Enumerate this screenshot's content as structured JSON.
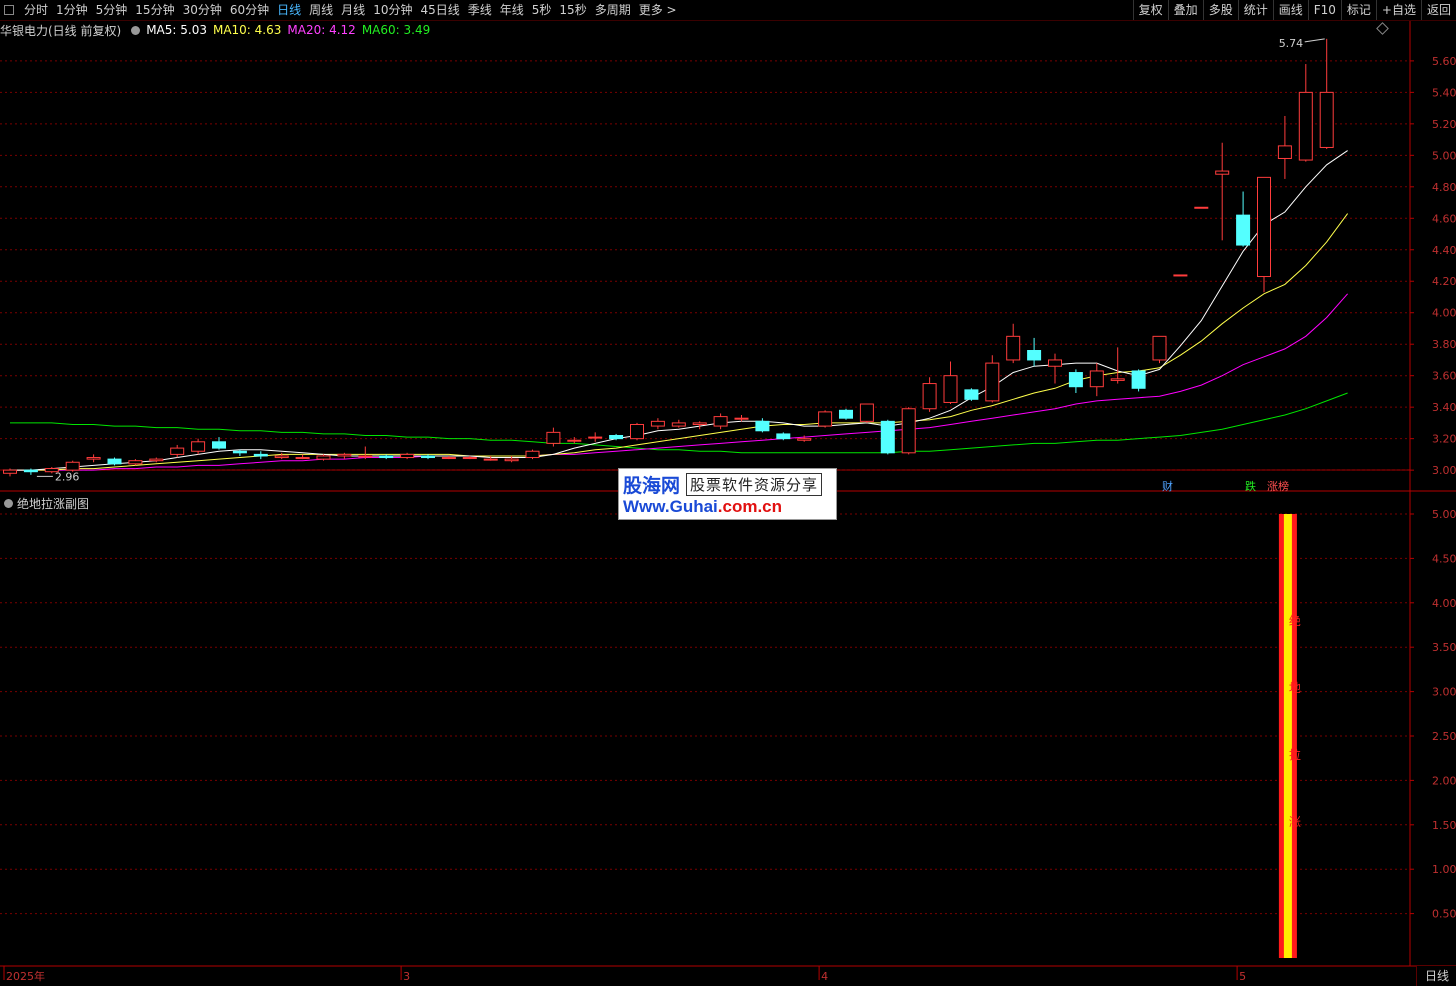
{
  "toolbar": {
    "periods": [
      "分时",
      "1分钟",
      "5分钟",
      "15分钟",
      "30分钟",
      "60分钟",
      "日线",
      "周线",
      "月线",
      "10分钟",
      "45日线",
      "季线",
      "年线",
      "5秒",
      "15秒",
      "多周期",
      "更多 >"
    ],
    "active_period": "日线",
    "actions": [
      "复权",
      "叠加",
      "多股",
      "统计",
      "画线",
      "F10",
      "标记",
      "+自选",
      "返回"
    ]
  },
  "info": {
    "title": "华银电力(日线 前复权)",
    "ma5": "MA5: 5.03",
    "ma10": "MA10: 4.63",
    "ma20": "MA20: 4.12",
    "ma60": "MA60: 3.49"
  },
  "colors": {
    "up": "#ff3c3c",
    "down": "#54ffff",
    "ma5": "#ffffff",
    "ma10": "#ffff4c",
    "ma20": "#ff00ff",
    "ma60": "#00e600",
    "axis": "#b40000",
    "grid": "#7a0000"
  },
  "subchart": {
    "title": "绝地拉涨副图"
  },
  "watermark": {
    "logo": "股海网",
    "tagline": "股票软件资源分享",
    "url_pre": "Www.",
    "url_mid": "Guhai",
    "url_post": ".com.cn"
  },
  "period_button": "日线",
  "chart_data": [
    {
      "type": "candlestick",
      "ylim": [
        2.95,
        5.72
      ],
      "yticks": [
        "3.00",
        "3.20",
        "3.40",
        "3.60",
        "3.80",
        "4.00",
        "4.20",
        "4.40",
        "4.60",
        "4.80",
        "5.00",
        "5.20",
        "5.40",
        "5.60"
      ],
      "ytick_values": [
        3.0,
        3.2,
        3.4,
        3.6,
        3.8,
        4.0,
        4.2,
        4.4,
        4.6,
        4.8,
        5.0,
        5.2,
        5.4,
        5.6
      ],
      "annotations": {
        "high": "5.74",
        "low": "2.96",
        "events": [
          "财",
          "跌",
          "涨榜"
        ]
      },
      "x_labels": [
        "2025年",
        "3",
        "4",
        "5"
      ],
      "x_label_index": [
        0,
        19,
        39,
        59
      ],
      "candles": [
        {
          "o": 2.98,
          "c": 3.0,
          "h": 3.01,
          "l": 2.96
        },
        {
          "o": 3.0,
          "c": 2.99,
          "h": 3.01,
          "l": 2.97
        },
        {
          "o": 2.99,
          "c": 3.01,
          "h": 3.02,
          "l": 2.98
        },
        {
          "o": 3.0,
          "c": 3.05,
          "h": 3.06,
          "l": 2.99
        },
        {
          "o": 3.07,
          "c": 3.08,
          "h": 3.1,
          "l": 3.05
        },
        {
          "o": 3.07,
          "c": 3.04,
          "h": 3.08,
          "l": 3.03
        },
        {
          "o": 3.04,
          "c": 3.06,
          "h": 3.07,
          "l": 3.03
        },
        {
          "o": 3.06,
          "c": 3.07,
          "h": 3.08,
          "l": 3.05
        },
        {
          "o": 3.1,
          "c": 3.14,
          "h": 3.16,
          "l": 3.08
        },
        {
          "o": 3.12,
          "c": 3.18,
          "h": 3.2,
          "l": 3.1
        },
        {
          "o": 3.18,
          "c": 3.14,
          "h": 3.21,
          "l": 3.13
        },
        {
          "o": 3.12,
          "c": 3.11,
          "h": 3.13,
          "l": 3.09
        },
        {
          "o": 3.1,
          "c": 3.09,
          "h": 3.12,
          "l": 3.07
        },
        {
          "o": 3.08,
          "c": 3.09,
          "h": 3.11,
          "l": 3.07
        },
        {
          "o": 3.08,
          "c": 3.08,
          "h": 3.1,
          "l": 3.07
        },
        {
          "o": 3.07,
          "c": 3.09,
          "h": 3.1,
          "l": 3.06
        },
        {
          "o": 3.09,
          "c": 3.1,
          "h": 3.11,
          "l": 3.07
        },
        {
          "o": 3.09,
          "c": 3.09,
          "h": 3.15,
          "l": 3.07
        },
        {
          "o": 3.09,
          "c": 3.08,
          "h": 3.1,
          "l": 3.07
        },
        {
          "o": 3.08,
          "c": 3.1,
          "h": 3.11,
          "l": 3.07
        },
        {
          "o": 3.09,
          "c": 3.08,
          "h": 3.1,
          "l": 3.07
        },
        {
          "o": 3.08,
          "c": 3.08,
          "h": 3.09,
          "l": 3.07
        },
        {
          "o": 3.08,
          "c": 3.08,
          "h": 3.09,
          "l": 3.07
        },
        {
          "o": 3.07,
          "c": 3.07,
          "h": 3.09,
          "l": 3.06
        },
        {
          "o": 3.06,
          "c": 3.07,
          "h": 3.09,
          "l": 3.05
        },
        {
          "o": 3.08,
          "c": 3.12,
          "h": 3.13,
          "l": 3.07
        },
        {
          "o": 3.17,
          "c": 3.24,
          "h": 3.27,
          "l": 3.15
        },
        {
          "o": 3.19,
          "c": 3.19,
          "h": 3.21,
          "l": 3.17
        },
        {
          "o": 3.21,
          "c": 3.21,
          "h": 3.24,
          "l": 3.18
        },
        {
          "o": 3.22,
          "c": 3.2,
          "h": 3.23,
          "l": 3.19
        },
        {
          "o": 3.2,
          "c": 3.29,
          "h": 3.3,
          "l": 3.19
        },
        {
          "o": 3.28,
          "c": 3.31,
          "h": 3.33,
          "l": 3.26
        },
        {
          "o": 3.28,
          "c": 3.3,
          "h": 3.32,
          "l": 3.27
        },
        {
          "o": 3.29,
          "c": 3.3,
          "h": 3.31,
          "l": 3.26
        },
        {
          "o": 3.28,
          "c": 3.34,
          "h": 3.36,
          "l": 3.26
        },
        {
          "o": 3.33,
          "c": 3.33,
          "h": 3.35,
          "l": 3.31
        },
        {
          "o": 3.31,
          "c": 3.25,
          "h": 3.33,
          "l": 3.24
        },
        {
          "o": 3.23,
          "c": 3.2,
          "h": 3.24,
          "l": 3.19
        },
        {
          "o": 3.19,
          "c": 3.2,
          "h": 3.22,
          "l": 3.18
        },
        {
          "o": 3.28,
          "c": 3.37,
          "h": 3.38,
          "l": 3.27
        },
        {
          "o": 3.38,
          "c": 3.33,
          "h": 3.39,
          "l": 3.32
        },
        {
          "o": 3.31,
          "c": 3.42,
          "h": 3.42,
          "l": 3.3
        },
        {
          "o": 3.31,
          "c": 3.11,
          "h": 3.32,
          "l": 3.1
        },
        {
          "o": 3.11,
          "c": 3.39,
          "h": 3.4,
          "l": 3.1
        },
        {
          "o": 3.39,
          "c": 3.55,
          "h": 3.59,
          "l": 3.37
        },
        {
          "o": 3.43,
          "c": 3.6,
          "h": 3.69,
          "l": 3.42
        },
        {
          "o": 3.51,
          "c": 3.45,
          "h": 3.52,
          "l": 3.44
        },
        {
          "o": 3.44,
          "c": 3.68,
          "h": 3.73,
          "l": 3.43
        },
        {
          "o": 3.7,
          "c": 3.85,
          "h": 3.93,
          "l": 3.68
        },
        {
          "o": 3.76,
          "c": 3.7,
          "h": 3.84,
          "l": 3.66
        },
        {
          "o": 3.66,
          "c": 3.7,
          "h": 3.74,
          "l": 3.55
        },
        {
          "o": 3.62,
          "c": 3.53,
          "h": 3.64,
          "l": 3.49
        },
        {
          "o": 3.53,
          "c": 3.63,
          "h": 3.68,
          "l": 3.47
        },
        {
          "o": 3.57,
          "c": 3.58,
          "h": 3.78,
          "l": 3.55
        },
        {
          "o": 3.63,
          "c": 3.52,
          "h": 3.64,
          "l": 3.5
        },
        {
          "o": 3.7,
          "c": 3.85,
          "h": 3.85,
          "l": 3.68
        },
        {
          "o": 4.24,
          "c": 4.24,
          "h": 4.24,
          "l": 4.24
        },
        {
          "o": 4.67,
          "c": 4.67,
          "h": 4.67,
          "l": 4.67
        },
        {
          "o": 4.88,
          "c": 4.9,
          "h": 5.08,
          "l": 4.46
        },
        {
          "o": 4.62,
          "c": 4.43,
          "h": 4.77,
          "l": 4.42
        },
        {
          "o": 4.23,
          "c": 4.86,
          "h": 4.86,
          "l": 4.13
        },
        {
          "o": 4.98,
          "c": 5.06,
          "h": 5.25,
          "l": 4.85
        },
        {
          "o": 4.97,
          "c": 5.4,
          "h": 5.58,
          "l": 4.96
        },
        {
          "o": 5.05,
          "c": 5.4,
          "h": 5.74,
          "l": 5.04
        }
      ],
      "ma5": [
        3.0,
        3.0,
        3.01,
        3.02,
        3.03,
        3.04,
        3.05,
        3.06,
        3.08,
        3.1,
        3.12,
        3.13,
        3.13,
        3.12,
        3.11,
        3.1,
        3.09,
        3.09,
        3.09,
        3.09,
        3.09,
        3.09,
        3.09,
        3.08,
        3.08,
        3.08,
        3.1,
        3.14,
        3.17,
        3.2,
        3.22,
        3.25,
        3.26,
        3.28,
        3.3,
        3.31,
        3.31,
        3.3,
        3.28,
        3.28,
        3.29,
        3.3,
        3.28,
        3.3,
        3.33,
        3.38,
        3.46,
        3.53,
        3.62,
        3.66,
        3.67,
        3.68,
        3.68,
        3.63,
        3.6,
        3.64,
        3.79,
        3.95,
        4.17,
        4.39,
        4.56,
        4.64,
        4.8,
        4.94,
        5.03
      ],
      "ma10": [
        3.0,
        3.0,
        3.0,
        3.01,
        3.01,
        3.02,
        3.03,
        3.04,
        3.05,
        3.06,
        3.07,
        3.08,
        3.09,
        3.1,
        3.1,
        3.1,
        3.1,
        3.1,
        3.1,
        3.1,
        3.1,
        3.1,
        3.09,
        3.09,
        3.09,
        3.09,
        3.1,
        3.11,
        3.13,
        3.14,
        3.16,
        3.18,
        3.2,
        3.22,
        3.24,
        3.26,
        3.28,
        3.29,
        3.29,
        3.3,
        3.3,
        3.3,
        3.3,
        3.31,
        3.32,
        3.34,
        3.38,
        3.41,
        3.45,
        3.49,
        3.52,
        3.57,
        3.6,
        3.62,
        3.63,
        3.65,
        3.73,
        3.82,
        3.93,
        4.03,
        4.12,
        4.18,
        4.3,
        4.45,
        4.63
      ],
      "ma20": [
        3.0,
        3.0,
        3.0,
        3.0,
        3.0,
        3.01,
        3.01,
        3.02,
        3.02,
        3.03,
        3.03,
        3.04,
        3.05,
        3.06,
        3.06,
        3.07,
        3.07,
        3.08,
        3.08,
        3.08,
        3.09,
        3.09,
        3.09,
        3.09,
        3.09,
        3.09,
        3.1,
        3.1,
        3.11,
        3.12,
        3.13,
        3.14,
        3.15,
        3.16,
        3.17,
        3.18,
        3.19,
        3.2,
        3.21,
        3.22,
        3.23,
        3.24,
        3.25,
        3.26,
        3.27,
        3.29,
        3.31,
        3.33,
        3.35,
        3.37,
        3.39,
        3.42,
        3.44,
        3.45,
        3.46,
        3.47,
        3.5,
        3.54,
        3.6,
        3.67,
        3.72,
        3.77,
        3.85,
        3.97,
        4.12
      ],
      "ma60": [
        3.3,
        3.3,
        3.3,
        3.29,
        3.29,
        3.28,
        3.28,
        3.27,
        3.27,
        3.26,
        3.26,
        3.25,
        3.25,
        3.24,
        3.24,
        3.23,
        3.23,
        3.22,
        3.22,
        3.21,
        3.21,
        3.2,
        3.2,
        3.19,
        3.19,
        3.18,
        3.17,
        3.17,
        3.16,
        3.15,
        3.14,
        3.13,
        3.13,
        3.12,
        3.12,
        3.11,
        3.11,
        3.11,
        3.11,
        3.11,
        3.11,
        3.11,
        3.11,
        3.12,
        3.12,
        3.13,
        3.14,
        3.15,
        3.16,
        3.17,
        3.17,
        3.18,
        3.19,
        3.19,
        3.2,
        3.21,
        3.22,
        3.24,
        3.26,
        3.29,
        3.32,
        3.35,
        3.39,
        3.44,
        3.49
      ]
    },
    {
      "type": "bar",
      "title": "绝地拉涨副图",
      "ylim": [
        0,
        5.0
      ],
      "yticks": [
        "0.50",
        "1.00",
        "1.50",
        "2.00",
        "2.50",
        "3.00",
        "3.50",
        "4.00",
        "4.50",
        "5.00"
      ],
      "ytick_values": [
        0.5,
        1.0,
        1.5,
        2.0,
        2.5,
        3.0,
        3.5,
        4.0,
        4.5,
        5.0
      ],
      "signal_index": 61,
      "signal_value": 5.0,
      "signal_label": [
        "绝",
        "地",
        "拉",
        "涨"
      ]
    }
  ]
}
